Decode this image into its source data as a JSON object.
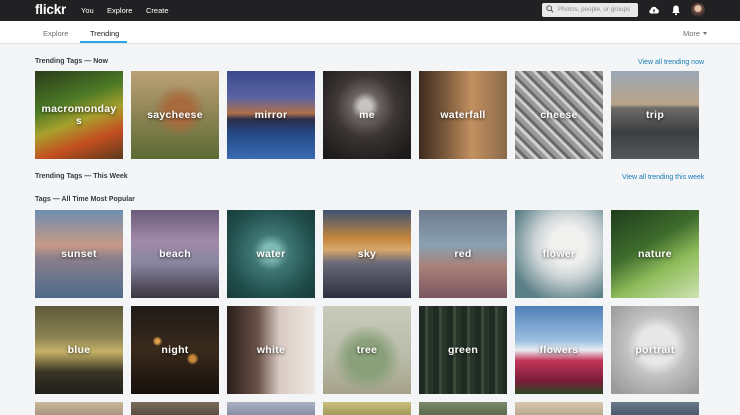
{
  "header": {
    "logo": "flickr",
    "nav": [
      "You",
      "Explore",
      "Create"
    ],
    "search_placeholder": "Photos, people, or groups",
    "icons": [
      "search-icon",
      "upload-cloud-icon",
      "notifications-bell-icon",
      "avatar"
    ]
  },
  "subnav": {
    "tabs": [
      "Explore",
      "Trending"
    ],
    "active_tab": "Trending",
    "more_label": "More"
  },
  "sections": {
    "trending_now": {
      "title": "Trending Tags — Now",
      "view_all": "View all trending now"
    },
    "trending_week": {
      "title": "Trending Tags — This Week",
      "view_all": "View all trending this week"
    },
    "all_time": {
      "title": "Tags — All Time Most Popular"
    }
  },
  "tiles": {
    "now": [
      "macromondays",
      "saycheese",
      "mirror",
      "me",
      "waterfall",
      "cheese",
      "trip"
    ],
    "popular_row1": [
      "sunset",
      "beach",
      "water",
      "sky",
      "red",
      "flower",
      "nature"
    ],
    "popular_row2": [
      "blue",
      "night",
      "white",
      "tree",
      "green",
      "flowers",
      "portrait"
    ]
  },
  "colors": {
    "topbar": "#212124",
    "accent_link": "#1679b6",
    "tab_underline": "#2aa5e9",
    "page_background": "#f3f5f6"
  }
}
